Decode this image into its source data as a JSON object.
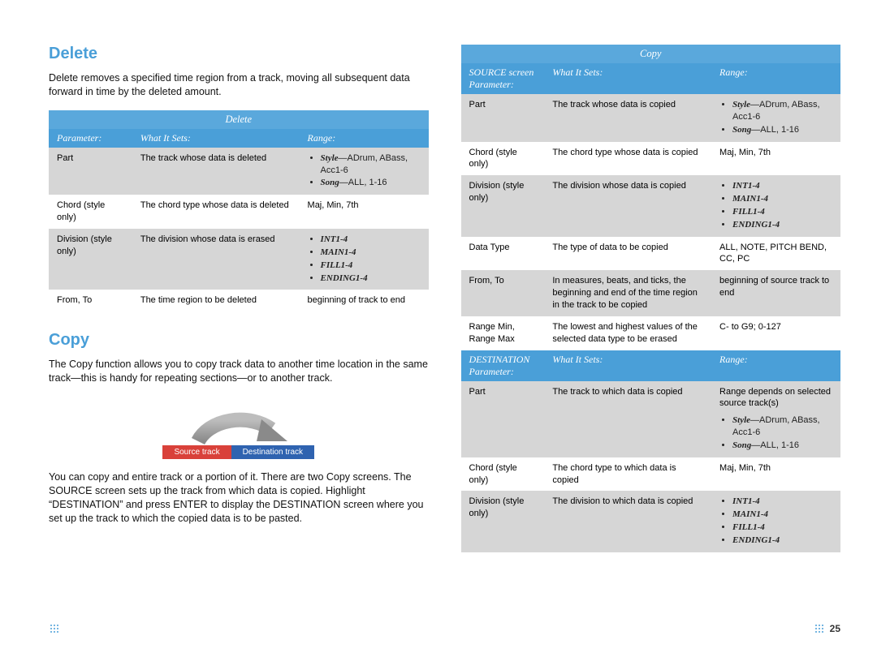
{
  "page_number": "25",
  "left": {
    "delete": {
      "heading": "Delete",
      "intro": "Delete removes a specified time region from a track, moving all subsequent data forward in time by the deleted amount.",
      "table": {
        "title": "Delete",
        "headers": {
          "c1": "Parameter:",
          "c2": "What It Sets:",
          "c3": "Range:"
        },
        "rows": [
          {
            "param": "Part",
            "what": "The track whose data is deleted",
            "range_bullets": [
              {
                "lead": "Style—",
                "tail": "ADrum, ABass, Acc1-6"
              },
              {
                "lead": "Song—",
                "tail": "ALL, 1-16"
              }
            ]
          },
          {
            "param": "Chord (style only)",
            "what": "The chord type whose data is deleted",
            "range_text": "Maj, Min, 7th"
          },
          {
            "param": "Division (style only)",
            "what": "The division whose data is erased",
            "range_list": [
              "INT1-4",
              "MAIN1-4",
              "FILL1-4",
              "ENDING1-4"
            ]
          },
          {
            "param": "From, To",
            "what": "The time region to be deleted",
            "range_text": "beginning of track to end"
          }
        ]
      }
    },
    "copy": {
      "heading": "Copy",
      "intro1": "The Copy function allows you to copy track data to another time location in the same track—this is handy for repeating sections—or to another track.",
      "labels": {
        "src": "Source track",
        "dst": "Destination track"
      },
      "intro2": "You can copy and entire track or a portion of it. There are two Copy screens. The SOURCE screen sets up the track from which data is copied. Highlight “DESTINATION” and press ENTER to display the DESTINATION screen where you set up the track to which the copied data is to be pasted."
    }
  },
  "right": {
    "table": {
      "title": "Copy",
      "src_headers": {
        "c1": "SOURCE screen Parameter:",
        "c2": "What It Sets:",
        "c3": "Range:"
      },
      "dst_headers": {
        "c1": "DESTINATION Parameter:",
        "c2": "What It Sets:",
        "c3": "Range:"
      },
      "src_rows": [
        {
          "param": "Part",
          "what": "The track whose data is copied",
          "range_bullets": [
            {
              "lead": "Style—",
              "tail": "ADrum, ABass, Acc1-6"
            },
            {
              "lead": "Song—",
              "tail": "ALL, 1-16"
            }
          ]
        },
        {
          "param": "Chord (style only)",
          "what": "The chord type whose data is copied",
          "range_text": "Maj, Min, 7th"
        },
        {
          "param": "Division (style only)",
          "what": "The division whose data is copied",
          "range_list": [
            "INT1-4",
            "MAIN1-4",
            "FILL1-4",
            "ENDING1-4"
          ]
        },
        {
          "param": "Data Type",
          "what": "The type of data to be copied",
          "range_text": "ALL, NOTE, PITCH BEND, CC, PC"
        },
        {
          "param": "From, To",
          "what": "In measures, beats, and ticks, the beginning and end of the time region in the track to be copied",
          "range_text": "beginning of source track to end"
        },
        {
          "param": "Range Min, Range Max",
          "what": "The lowest and highest values of the selected data type to be erased",
          "range_text": "C- to G9; 0-127"
        }
      ],
      "dst_rows": [
        {
          "param": "Part",
          "what": "The track to which data is copied",
          "range_pre": "Range depends on selected source track(s)",
          "range_bullets": [
            {
              "lead": "Style—",
              "tail": "ADrum, ABass, Acc1-6"
            },
            {
              "lead": "Song—",
              "tail": "ALL, 1-16"
            }
          ]
        },
        {
          "param": "Chord (style only)",
          "what": "The chord type to which data is copied",
          "range_text": "Maj, Min, 7th"
        },
        {
          "param": "Division (style only)",
          "what": "The division to which data is copied",
          "range_list": [
            "INT1-4",
            "MAIN1-4",
            "FILL1-4",
            "ENDING1-4"
          ]
        }
      ]
    }
  }
}
